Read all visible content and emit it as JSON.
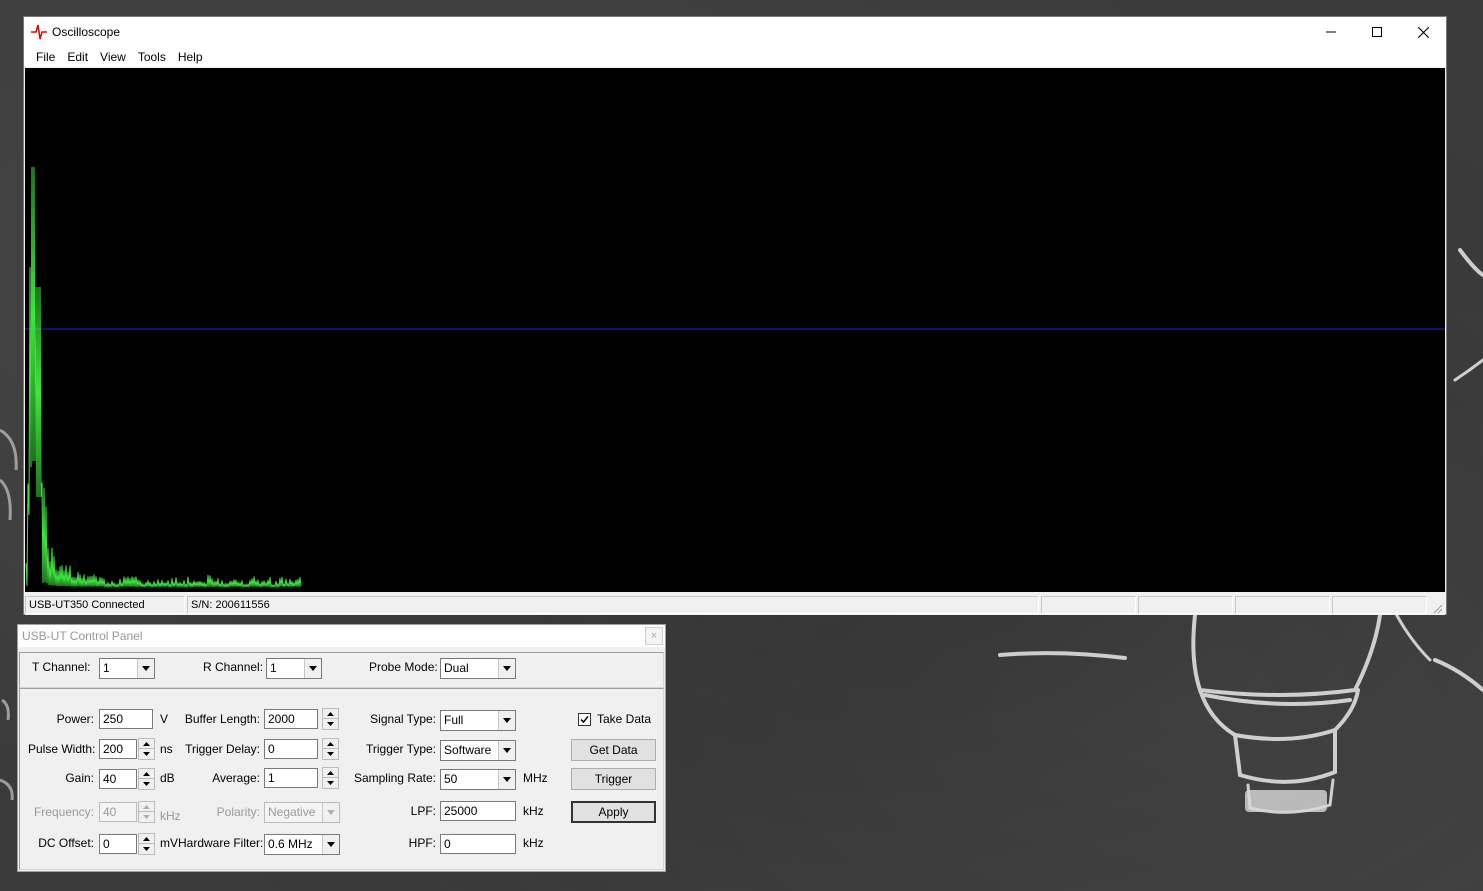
{
  "window": {
    "title": "Oscilloscope",
    "menu": [
      "File",
      "Edit",
      "View",
      "Tools",
      "Help"
    ]
  },
  "scope": {
    "background": "#000000",
    "trace_color": "#3ee63e",
    "baseline_color": "#1a1ab0"
  },
  "statusbar": {
    "connection": "USB-UT350 Connected",
    "serial": "S/N: 200611556"
  },
  "panel": {
    "title": "USB-UT Control Panel",
    "close_label": "×",
    "t_channel": {
      "label": "T Channel:",
      "value": "1"
    },
    "r_channel": {
      "label": "R Channel:",
      "value": "1"
    },
    "probe_mode": {
      "label": "Probe Mode:",
      "value": "Dual"
    },
    "power": {
      "label": "Power:",
      "value": "250",
      "unit": "V"
    },
    "pulse_width": {
      "label": "Pulse Width:",
      "value": "200",
      "unit": "ns"
    },
    "gain": {
      "label": "Gain:",
      "value": "40",
      "unit": "dB"
    },
    "frequency": {
      "label": "Frequency:",
      "value": "40",
      "unit": "kHz"
    },
    "dc_offset": {
      "label": "DC Offset:",
      "value": "0",
      "unit": "mV"
    },
    "buffer_length": {
      "label": "Buffer Length:",
      "value": "2000"
    },
    "trigger_delay": {
      "label": "Trigger Delay:",
      "value": "0"
    },
    "average": {
      "label": "Average:",
      "value": "1"
    },
    "polarity": {
      "label": "Polarity:",
      "value": "Negative"
    },
    "hardware_filter": {
      "label": "Hardware Filter:",
      "value": "0.6 MHz"
    },
    "signal_type": {
      "label": "Signal Type:",
      "value": "Full"
    },
    "trigger_type": {
      "label": "Trigger Type:",
      "value": "Software"
    },
    "sampling_rate": {
      "label": "Sampling Rate:",
      "value": "50",
      "unit": "MHz"
    },
    "lpf": {
      "label": "LPF:",
      "value": "25000",
      "unit": "kHz"
    },
    "hpf": {
      "label": "HPF:",
      "value": "0",
      "unit": "kHz"
    },
    "take_data": {
      "label": "Take Data",
      "checked": true
    },
    "get_data_label": "Get Data",
    "trigger_label": "Trigger",
    "apply_label": "Apply"
  }
}
